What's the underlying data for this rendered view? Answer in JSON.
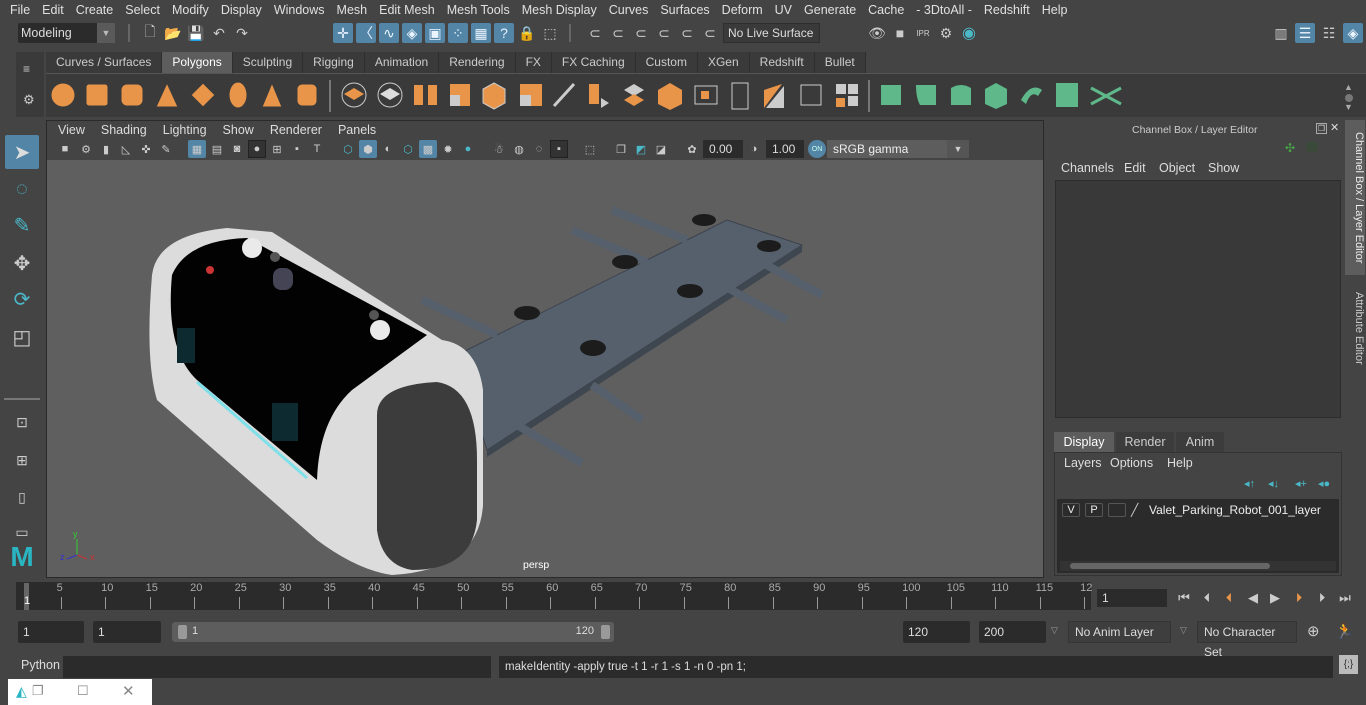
{
  "menubar": [
    "File",
    "Edit",
    "Create",
    "Select",
    "Modify",
    "Display",
    "Windows",
    "Mesh",
    "Edit Mesh",
    "Mesh Tools",
    "Mesh Display",
    "Curves",
    "Surfaces",
    "Deform",
    "UV",
    "Generate",
    "Cache",
    "- 3DtoAll -",
    "Redshift",
    "Help"
  ],
  "status_line": {
    "mode": "Modeling",
    "live_surface": "No Live Surface"
  },
  "shelf": {
    "tabs": [
      "Curves / Surfaces",
      "Polygons",
      "Sculpting",
      "Rigging",
      "Animation",
      "Rendering",
      "FX",
      "FX Caching",
      "Custom",
      "XGen",
      "Redshift",
      "Bullet"
    ],
    "active_tab": "Polygons"
  },
  "viewport": {
    "menu": [
      "View",
      "Shading",
      "Lighting",
      "Show",
      "Renderer",
      "Panels"
    ],
    "exposure": "0.00",
    "gamma": "1.00",
    "color_mgmt_toggle": "ON",
    "color_space": "sRGB gamma",
    "camera_label": "persp",
    "axis": {
      "x": "x",
      "y": "y",
      "z": "z"
    }
  },
  "channel_box": {
    "title": "Channel Box / Layer Editor",
    "menu": [
      "Channels",
      "Edit",
      "Object",
      "Show"
    ],
    "side_tabs": [
      "Channel Box / Layer Editor",
      "Attribute Editor"
    ]
  },
  "layer_editor": {
    "tabs": [
      "Display",
      "Render",
      "Anim"
    ],
    "active_tab": "Display",
    "menu": [
      "Layers",
      "Options",
      "Help"
    ],
    "layers": [
      {
        "visible": "V",
        "playback": "P",
        "name": "Valet_Parking_Robot_001_layer"
      }
    ]
  },
  "timeline": {
    "ticks": [
      "5",
      "10",
      "15",
      "20",
      "25",
      "30",
      "35",
      "40",
      "45",
      "50",
      "55",
      "60",
      "65",
      "70",
      "75",
      "80",
      "85",
      "90",
      "95",
      "100",
      "105",
      "110",
      "115",
      "12"
    ],
    "playhead": "1",
    "current_frame": "1"
  },
  "range": {
    "start": "1",
    "playback_start": "1",
    "slider_start": "1",
    "slider_end": "120",
    "playback_end": "120",
    "end": "200",
    "anim_layer": "No Anim Layer",
    "character_set": "No Character Set"
  },
  "command_line": {
    "language": "Python",
    "input": "",
    "result": "makeIdentity -apply true -t 1 -r 1 -s 1 -n 0 -pn 1;"
  }
}
